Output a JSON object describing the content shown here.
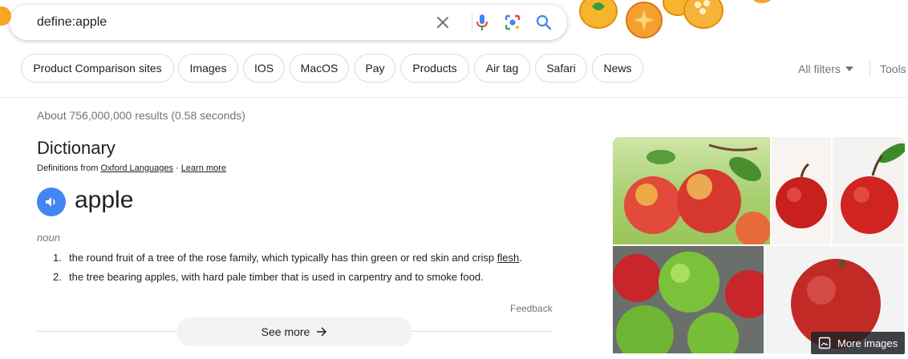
{
  "search": {
    "query": "define:apple"
  },
  "icons": {
    "clear": "close-icon",
    "mic": "microphone-icon",
    "lens": "google-lens-icon",
    "search": "search-icon"
  },
  "colors": {
    "google_blue": "#4285f4",
    "text": "#202124",
    "secondary_text": "#70757a",
    "chip_border": "#dadce0"
  },
  "chips": [
    "Product Comparison sites",
    "Images",
    "IOS",
    "MacOS",
    "Pay",
    "Products",
    "Air tag",
    "Safari",
    "News"
  ],
  "filters": {
    "all_filters": "All filters",
    "tools": "Tools"
  },
  "results": {
    "stats": "About 756,000,000 results (0.58 seconds)"
  },
  "dictionary": {
    "title": "Dictionary",
    "source_prefix": "Definitions from ",
    "source_name": "Oxford Languages",
    "separator": " · ",
    "learn_more": "Learn more",
    "word": "apple",
    "part_of_speech": "noun",
    "definitions": [
      {
        "num": "1.",
        "text": "the round fruit of a tree of the rose family, which typically has thin green or red skin and crisp ",
        "link": "flesh",
        "end": "."
      },
      {
        "num": "2.",
        "text": "the tree bearing apples, with hard pale timber that is used in carpentry and to smoke food.",
        "link": "",
        "end": ""
      }
    ],
    "feedback": "Feedback",
    "see_more": "See more"
  },
  "images_panel": {
    "more_images": "More images"
  }
}
